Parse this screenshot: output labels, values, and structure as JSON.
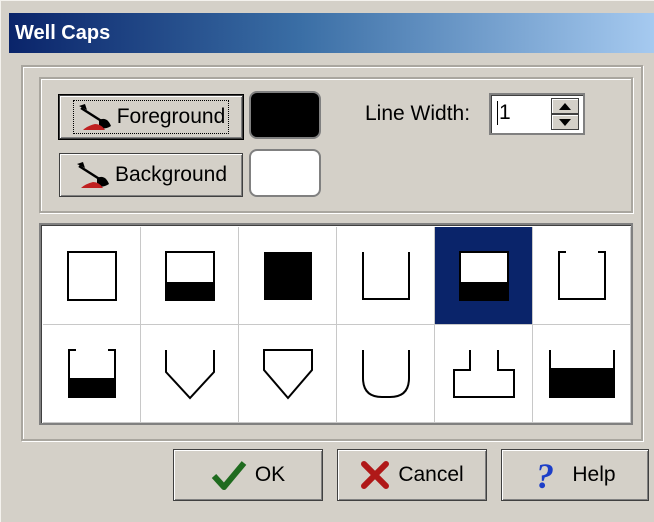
{
  "window": {
    "title": "Well Caps"
  },
  "colors": {
    "title_bar_start": "#0a246a",
    "title_bar_end": "#a6caf0",
    "foreground_swatch": "#000000",
    "background_swatch": "#ffffff",
    "selected_cell": "#0a246a"
  },
  "controls": {
    "foreground_label": "Foreground",
    "background_label": "Background",
    "line_width_label": "Line Width:",
    "line_width_value": "1"
  },
  "caps": {
    "selected_index": 4,
    "items": [
      "open-box",
      "box-bottom-fill",
      "filled-box",
      "u-cup",
      "box-bottom-fill-selected",
      "bracket-cup",
      "bracket-bottom-fill",
      "v-funnel",
      "triangle-funnel",
      "rounded-u",
      "flanged-cap",
      "wide-bottom-fill"
    ]
  },
  "footer": {
    "ok_label": "OK",
    "cancel_label": "Cancel",
    "help_label": "Help"
  },
  "icons": {
    "brush": "brush-icon",
    "ok": "checkmark-icon",
    "cancel": "x-mark-icon",
    "help": "question-mark-icon"
  }
}
